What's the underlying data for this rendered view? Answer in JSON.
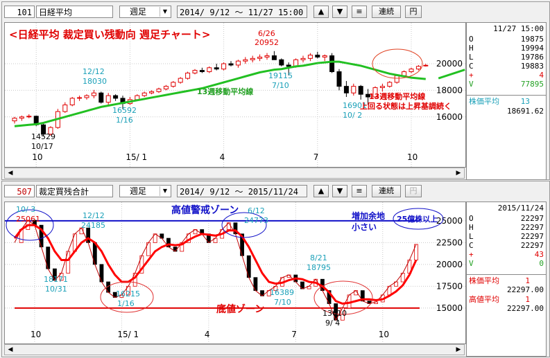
{
  "panel1": {
    "code": "101",
    "name": "日経平均",
    "period": "週足",
    "range": "2014/ 9/12 〜 11/27 15:00",
    "btn_up": "▲",
    "btn_down": "▼",
    "btn_menu": "≡",
    "btn_link": "連続",
    "btn_yen": "円",
    "chart_title": "<日経平均  裁定買い残動向  週足チャート>",
    "xaxis_ticks": [
      "10",
      "15/ 1",
      "4",
      "7",
      "10"
    ],
    "yaxis_ticks": [
      "20000",
      "18000",
      "16000"
    ],
    "annotations": {
      "a1": "12/12",
      "a1b": "18030",
      "a2": "6/26",
      "a2b": "20952",
      "a3": "19115",
      "a3b": "7/10",
      "a4": "16592",
      "a4b": "1/16",
      "a5": "14529",
      "a5b": "10/17",
      "a6": "16901",
      "a6b": "10/ 2",
      "ma_label": "13週移動平均線",
      "note1": "13週移動平均線",
      "note2": "上回る状態は上昇基調続く"
    },
    "info": {
      "header": "11/27 15:00",
      "rows": [
        {
          "k": "O",
          "v": "19875"
        },
        {
          "k": "H",
          "v": "19994"
        },
        {
          "k": "L",
          "v": "19786"
        },
        {
          "k": "C",
          "v": "19883"
        },
        {
          "k": "+",
          "v": "4"
        },
        {
          "k": "V",
          "v": "77895"
        }
      ],
      "ma_label": "株価平均",
      "ma_n": "13",
      "ma_value": "18691.62"
    }
  },
  "panel2": {
    "code": "507",
    "name": "裁定買残合計",
    "period": "週足",
    "range": "2014/ 9/12 〜  2015/11/24",
    "btn_up": "▲",
    "btn_down": "▼",
    "btn_menu": "≡",
    "btn_link": "連続",
    "btn_yen": "円",
    "xaxis_ticks": [
      "10",
      "15/ 1",
      "4",
      "7",
      "10"
    ],
    "yaxis_ticks": [
      "25000",
      "22500",
      "20000",
      "17500",
      "15000"
    ],
    "annotations": {
      "high_zone": "高値警戒ゾーン",
      "low_zone": "底値ゾーン",
      "room1": "増加余地",
      "room2": "小さい",
      "bubble": "25億株以上",
      "b1": "10/ 3",
      "b1b": "25061",
      "b2": "12/12",
      "b2b": "24185",
      "b3": "6/12",
      "b3b": "24773",
      "b4": "8/21",
      "b4b": "18795",
      "b5": "18171",
      "b5b": "10/31",
      "b6": "16215",
      "b6b": "1/16",
      "b7": "16389",
      "b7b": "7/10",
      "b8": "13610",
      "b8b": "9/ 4"
    },
    "info": {
      "header": "2015/11/24",
      "rows": [
        {
          "k": "O",
          "v": "22297"
        },
        {
          "k": "H",
          "v": "22297"
        },
        {
          "k": "L",
          "v": "22297"
        },
        {
          "k": "C",
          "v": "22297"
        },
        {
          "k": "+",
          "v": "43"
        },
        {
          "k": "V",
          "v": "0"
        }
      ],
      "ma1_label": "株価平均",
      "ma1_n": "1",
      "ma1_value": "22297.00",
      "ma2_label": "高値平均",
      "ma2_n": "1",
      "ma2_value": "22297.00"
    }
  },
  "colors": {
    "up": "#e00000",
    "down": "#000000",
    "ma": "#22c022",
    "cyan": "#1aa0b8",
    "blue": "#1010c8",
    "red": "#e00000"
  },
  "chart_data": [
    {
      "type": "candlestick",
      "title": "<日経平均  裁定買い残動向  週足チャート>",
      "ylim": [
        13800,
        21200
      ],
      "candles": [
        {
          "o": 15700,
          "h": 16000,
          "l": 15500,
          "c": 15900
        },
        {
          "o": 15900,
          "h": 16100,
          "l": 15700,
          "c": 16000
        },
        {
          "o": 16000,
          "h": 16200,
          "l": 15900,
          "c": 16050
        },
        {
          "o": 16050,
          "h": 16100,
          "l": 15300,
          "c": 15400
        },
        {
          "o": 15400,
          "h": 15600,
          "l": 14529,
          "c": 14700
        },
        {
          "o": 14700,
          "h": 15300,
          "l": 14600,
          "c": 15200
        },
        {
          "o": 15200,
          "h": 16600,
          "l": 15100,
          "c": 16400
        },
        {
          "o": 16400,
          "h": 17100,
          "l": 16300,
          "c": 16900
        },
        {
          "o": 16900,
          "h": 17500,
          "l": 16800,
          "c": 17400
        },
        {
          "o": 17400,
          "h": 17600,
          "l": 17200,
          "c": 17450
        },
        {
          "o": 17450,
          "h": 17700,
          "l": 17300,
          "c": 17600
        },
        {
          "o": 17600,
          "h": 18030,
          "l": 17400,
          "c": 17800
        },
        {
          "o": 17800,
          "h": 17900,
          "l": 17000,
          "c": 17100
        },
        {
          "o": 17100,
          "h": 17800,
          "l": 16900,
          "c": 17600
        },
        {
          "o": 17600,
          "h": 17700,
          "l": 17200,
          "c": 17400
        },
        {
          "o": 17400,
          "h": 17600,
          "l": 16592,
          "c": 17000
        },
        {
          "o": 17000,
          "h": 17500,
          "l": 16900,
          "c": 17300
        },
        {
          "o": 17300,
          "h": 17700,
          "l": 17200,
          "c": 17600
        },
        {
          "o": 17600,
          "h": 17900,
          "l": 17500,
          "c": 17800
        },
        {
          "o": 17800,
          "h": 18000,
          "l": 17700,
          "c": 17900
        },
        {
          "o": 17900,
          "h": 18200,
          "l": 17800,
          "c": 18100
        },
        {
          "o": 18100,
          "h": 18400,
          "l": 18000,
          "c": 18300
        },
        {
          "o": 18300,
          "h": 18700,
          "l": 18200,
          "c": 18600
        },
        {
          "o": 18600,
          "h": 19000,
          "l": 18500,
          "c": 18900
        },
        {
          "o": 18900,
          "h": 19400,
          "l": 18800,
          "c": 19300
        },
        {
          "o": 19300,
          "h": 19600,
          "l": 19200,
          "c": 19500
        },
        {
          "o": 19500,
          "h": 19700,
          "l": 19300,
          "c": 19400
        },
        {
          "o": 19400,
          "h": 19800,
          "l": 19300,
          "c": 19700
        },
        {
          "o": 19700,
          "h": 20000,
          "l": 19500,
          "c": 19600
        },
        {
          "o": 19600,
          "h": 20100,
          "l": 19500,
          "c": 20000
        },
        {
          "o": 20000,
          "h": 20200,
          "l": 19800,
          "c": 19900
        },
        {
          "o": 19900,
          "h": 20300,
          "l": 19700,
          "c": 20200
        },
        {
          "o": 20200,
          "h": 20500,
          "l": 20000,
          "c": 20300
        },
        {
          "o": 20300,
          "h": 20600,
          "l": 20100,
          "c": 20400
        },
        {
          "o": 20400,
          "h": 20700,
          "l": 20200,
          "c": 20500
        },
        {
          "o": 20500,
          "h": 20800,
          "l": 20300,
          "c": 20600
        },
        {
          "o": 20600,
          "h": 20952,
          "l": 20400,
          "c": 20300
        },
        {
          "o": 20300,
          "h": 20400,
          "l": 19800,
          "c": 19900
        },
        {
          "o": 19900,
          "h": 20100,
          "l": 19115,
          "c": 19800
        },
        {
          "o": 19800,
          "h": 20400,
          "l": 19700,
          "c": 20300
        },
        {
          "o": 20300,
          "h": 20600,
          "l": 20100,
          "c": 20400
        },
        {
          "o": 20400,
          "h": 20800,
          "l": 20200,
          "c": 20650
        },
        {
          "o": 20650,
          "h": 20900,
          "l": 20400,
          "c": 20500
        },
        {
          "o": 20500,
          "h": 20700,
          "l": 20200,
          "c": 20600
        },
        {
          "o": 20600,
          "h": 20800,
          "l": 19300,
          "c": 19400
        },
        {
          "o": 19400,
          "h": 19600,
          "l": 18000,
          "c": 18300
        },
        {
          "o": 18300,
          "h": 18700,
          "l": 17500,
          "c": 17800
        },
        {
          "o": 17800,
          "h": 18500,
          "l": 17600,
          "c": 18300
        },
        {
          "o": 18300,
          "h": 18400,
          "l": 17300,
          "c": 17700
        },
        {
          "o": 17700,
          "h": 18100,
          "l": 16901,
          "c": 17500
        },
        {
          "o": 17500,
          "h": 18300,
          "l": 17400,
          "c": 18200
        },
        {
          "o": 18200,
          "h": 18500,
          "l": 17900,
          "c": 18300
        },
        {
          "o": 18300,
          "h": 18700,
          "l": 18200,
          "c": 18600
        },
        {
          "o": 18600,
          "h": 19200,
          "l": 18500,
          "c": 19100
        },
        {
          "o": 19100,
          "h": 19500,
          "l": 19000,
          "c": 19400
        },
        {
          "o": 19400,
          "h": 19700,
          "l": 19300,
          "c": 19600
        },
        {
          "o": 19600,
          "h": 19900,
          "l": 19500,
          "c": 19800
        },
        {
          "o": 19875,
          "h": 19994,
          "l": 19786,
          "c": 19883
        }
      ],
      "ma13": [
        15300,
        15350,
        15400,
        15450,
        15550,
        15700,
        15850,
        16000,
        16150,
        16300,
        16450,
        16600,
        16750,
        16850,
        16950,
        17050,
        17150,
        17250,
        17350,
        17450,
        17550,
        17650,
        17750,
        17850,
        17950,
        18050,
        18150,
        18300,
        18450,
        18600,
        18750,
        18900,
        19050,
        19200,
        19350,
        19450,
        19550,
        19600,
        19700,
        19800,
        19850,
        19950,
        20050,
        20100,
        20150,
        20150,
        20050,
        19950,
        19850,
        19700,
        19550,
        19400,
        19250,
        19150,
        19050,
        18950,
        18900,
        18850
      ],
      "ma13_projection": [
        18900,
        19550
      ]
    },
    {
      "type": "line",
      "ylim": [
        13000,
        26500
      ],
      "series": [
        {
          "values": [
            22500,
            24000,
            25061,
            24500,
            22000,
            19500,
            18171,
            19000,
            21500,
            23500,
            24185,
            22500,
            20000,
            18000,
            16800,
            16215,
            16500,
            17500,
            19000,
            21000,
            22500,
            23500,
            23000,
            22000,
            21500,
            22500,
            23500,
            24000,
            23500,
            22500,
            23000,
            24000,
            24773,
            23500,
            21000,
            18500,
            17000,
            16389,
            17000,
            17500,
            18500,
            18795,
            18000,
            17200,
            17500,
            18300,
            17000,
            15500,
            13610,
            15000,
            16500,
            17000,
            15800,
            15500,
            15700,
            16500,
            17500,
            18000,
            19000,
            20500,
            22297
          ]
        },
        {
          "values": [
            23000,
            24000,
            24500,
            24500,
            24000,
            23000,
            21500,
            20500,
            20500,
            21500,
            22500,
            23000,
            22500,
            21500,
            20000,
            18800,
            18000,
            18000,
            18500,
            19500,
            20500,
            21500,
            22000,
            22300,
            22200,
            22300,
            22800,
            23200,
            23500,
            23400,
            23300,
            23500,
            23900,
            23900,
            23200,
            22000,
            20500,
            19000,
            18000,
            17800,
            17900,
            18200,
            18400,
            18300,
            18000,
            17900,
            17500,
            16800,
            15800,
            15500,
            15600,
            15800,
            16000,
            16000,
            15900,
            16000,
            16400,
            16900,
            17600,
            18800,
            20500
          ]
        }
      ],
      "hlines": [
        25000,
        15000
      ]
    }
  ]
}
